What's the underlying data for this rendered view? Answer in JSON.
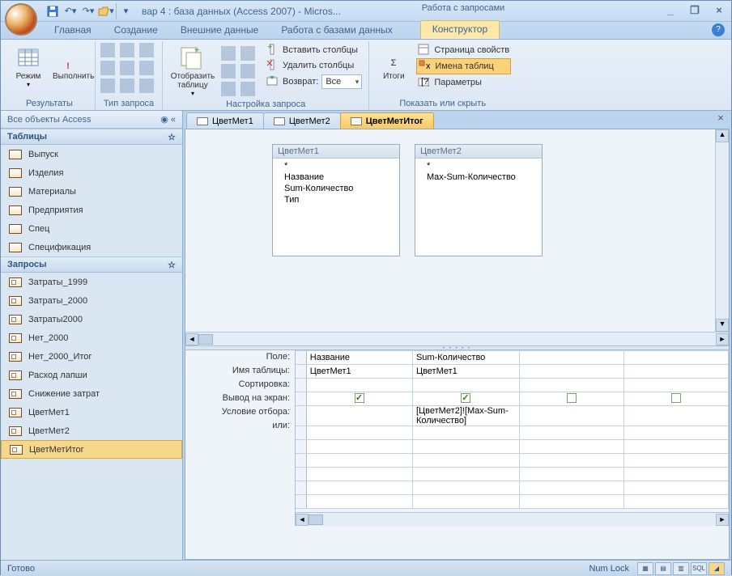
{
  "title": "вар 4 : база данных (Access 2007) - Micros...",
  "context_label": "Работа с запросами",
  "tabs": {
    "home": "Главная",
    "create": "Создание",
    "external": "Внешние данные",
    "dbtools": "Работа с базами данных",
    "design": "Конструктор"
  },
  "ribbon": {
    "results": {
      "view": "Режим",
      "run": "Выполнить",
      "label": "Результаты"
    },
    "qtype": {
      "label": "Тип запроса"
    },
    "setup": {
      "show_table": "Отобразить таблицу",
      "insert_cols": "Вставить столбцы",
      "delete_cols": "Удалить столбцы",
      "return": "Возврат:",
      "return_val": "Все",
      "label": "Настройка запроса"
    },
    "totals": {
      "totals": "Итоги",
      "prop_sheet": "Страница свойств",
      "table_names": "Имена таблиц",
      "params": "Параметры",
      "label": "Показать или скрыть"
    }
  },
  "nav": {
    "header": "Все объекты Access",
    "tables_h": "Таблицы",
    "tables": [
      "Выпуск",
      "Изделия",
      "Материалы",
      "Предприятия",
      "Спец",
      "Спецификация"
    ],
    "queries_h": "Запросы",
    "queries": [
      "Затраты_1999",
      "Затраты_2000",
      "Затраты2000",
      "Нет_2000",
      "Нет_2000_Итог",
      "Расход лапши",
      "Снижение затрат",
      "ЦветМет1",
      "ЦветМет2",
      "ЦветМетИтог"
    ],
    "selected_query": "ЦветМетИтог"
  },
  "doc_tabs": [
    "ЦветМет1",
    "ЦветМет2",
    "ЦветМетИтог"
  ],
  "active_doc": "ЦветМетИтог",
  "diagram": {
    "list1": {
      "title": "ЦветМет1",
      "fields": [
        "*",
        "Название",
        "Sum-Количество",
        "Тип"
      ]
    },
    "list2": {
      "title": "ЦветМет2",
      "fields": [
        "*",
        "Max-Sum-Количество"
      ]
    }
  },
  "grid": {
    "labels": {
      "field": "Поле:",
      "table": "Имя таблицы:",
      "sort": "Сортировка:",
      "show": "Вывод на экран:",
      "criteria": "Условие отбора:",
      "or": "или:"
    },
    "cols": [
      {
        "field": "Название",
        "table": "ЦветМет1",
        "show": true,
        "criteria": ""
      },
      {
        "field": "Sum-Количество",
        "table": "ЦветМет1",
        "show": true,
        "criteria": "[ЦветМет2]![Max-Sum-Количество]"
      },
      {
        "field": "",
        "table": "",
        "show": false,
        "criteria": ""
      },
      {
        "field": "",
        "table": "",
        "show": false,
        "criteria": ""
      }
    ]
  },
  "status": {
    "ready": "Готово",
    "numlock": "Num Lock",
    "sql": "SQL"
  }
}
